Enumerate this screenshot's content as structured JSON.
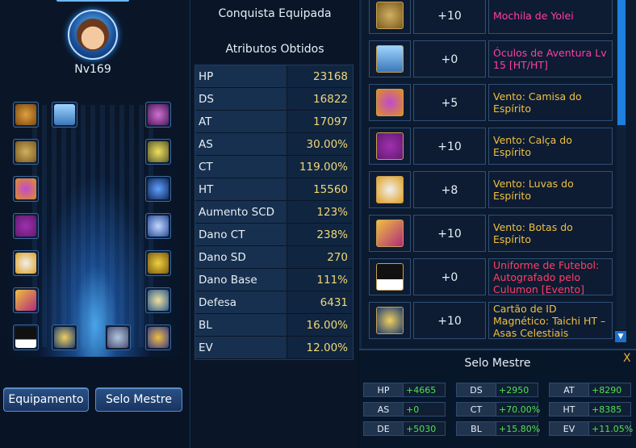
{
  "character": {
    "level": "Nv169"
  },
  "buttons": {
    "equipment": "Equipamento",
    "master_seal": "Selo Mestre"
  },
  "middle": {
    "title": "Conquista Equipada",
    "subtitle": "Atributos Obtidos",
    "attributes": [
      {
        "name": "HP",
        "value": "23168"
      },
      {
        "name": "DS",
        "value": "16822"
      },
      {
        "name": "AT",
        "value": "17097"
      },
      {
        "name": "AS",
        "value": "30.00%"
      },
      {
        "name": "CT",
        "value": "119.00%"
      },
      {
        "name": "HT",
        "value": "15560"
      },
      {
        "name": "Aumento SCD",
        "value": "123%"
      },
      {
        "name": "Dano CT",
        "value": "238%"
      },
      {
        "name": "Dano SD",
        "value": "270"
      },
      {
        "name": "Dano Base",
        "value": "111%"
      },
      {
        "name": "Defesa",
        "value": "6431"
      },
      {
        "name": "BL",
        "value": "16.00%"
      },
      {
        "name": "EV",
        "value": "12.00%"
      }
    ]
  },
  "items": [
    {
      "level": "+10",
      "name": "Mochila de Yolei",
      "color": "#ff3fa8",
      "icon": "backpack-icon"
    },
    {
      "level": "+0",
      "name": "Óculos de Aventura Lv 15 [HT/HT]",
      "color": "#ff3fa8",
      "icon": "goggles-icon"
    },
    {
      "level": "+5",
      "name": "Vento: Camisa do Espírito",
      "color": "#f0c040",
      "icon": "shirt-icon"
    },
    {
      "level": "+10",
      "name": "Vento: Calça do Espírito",
      "color": "#f0c040",
      "icon": "pants-icon"
    },
    {
      "level": "+8",
      "name": "Vento: Luvas do Espírito",
      "color": "#f0c040",
      "icon": "gloves-icon"
    },
    {
      "level": "+10",
      "name": "Vento: Botas do Espírito",
      "color": "#f0c040",
      "icon": "boots-icon"
    },
    {
      "level": "+0",
      "name": "Uniforme de Futebol: Autografado pelo Culumon [Evento]",
      "color": "#ff3f6a",
      "icon": "uniform-icon"
    },
    {
      "level": "+10",
      "name": "Cartão de ID Magnético: Taichi HT – Asas Celestiais",
      "color": "#f0c040",
      "icon": "id-card-icon"
    }
  ],
  "selo_mestre": {
    "title": "Selo Mestre",
    "close": "X",
    "stats": [
      {
        "name": "HP",
        "value": "+4665"
      },
      {
        "name": "DS",
        "value": "+2950"
      },
      {
        "name": "AT",
        "value": "+8290"
      },
      {
        "name": "AS",
        "value": "+0"
      },
      {
        "name": "CT",
        "value": "+70.00%"
      },
      {
        "name": "HT",
        "value": "+8385"
      },
      {
        "name": "DE",
        "value": "+5030"
      },
      {
        "name": "BL",
        "value": "+15.80%"
      },
      {
        "name": "EV",
        "value": "+11.05%"
      }
    ]
  },
  "colors": {
    "accent": "#1d7fe0",
    "stat_value": "#f0d878",
    "bonus": "#52e052"
  }
}
